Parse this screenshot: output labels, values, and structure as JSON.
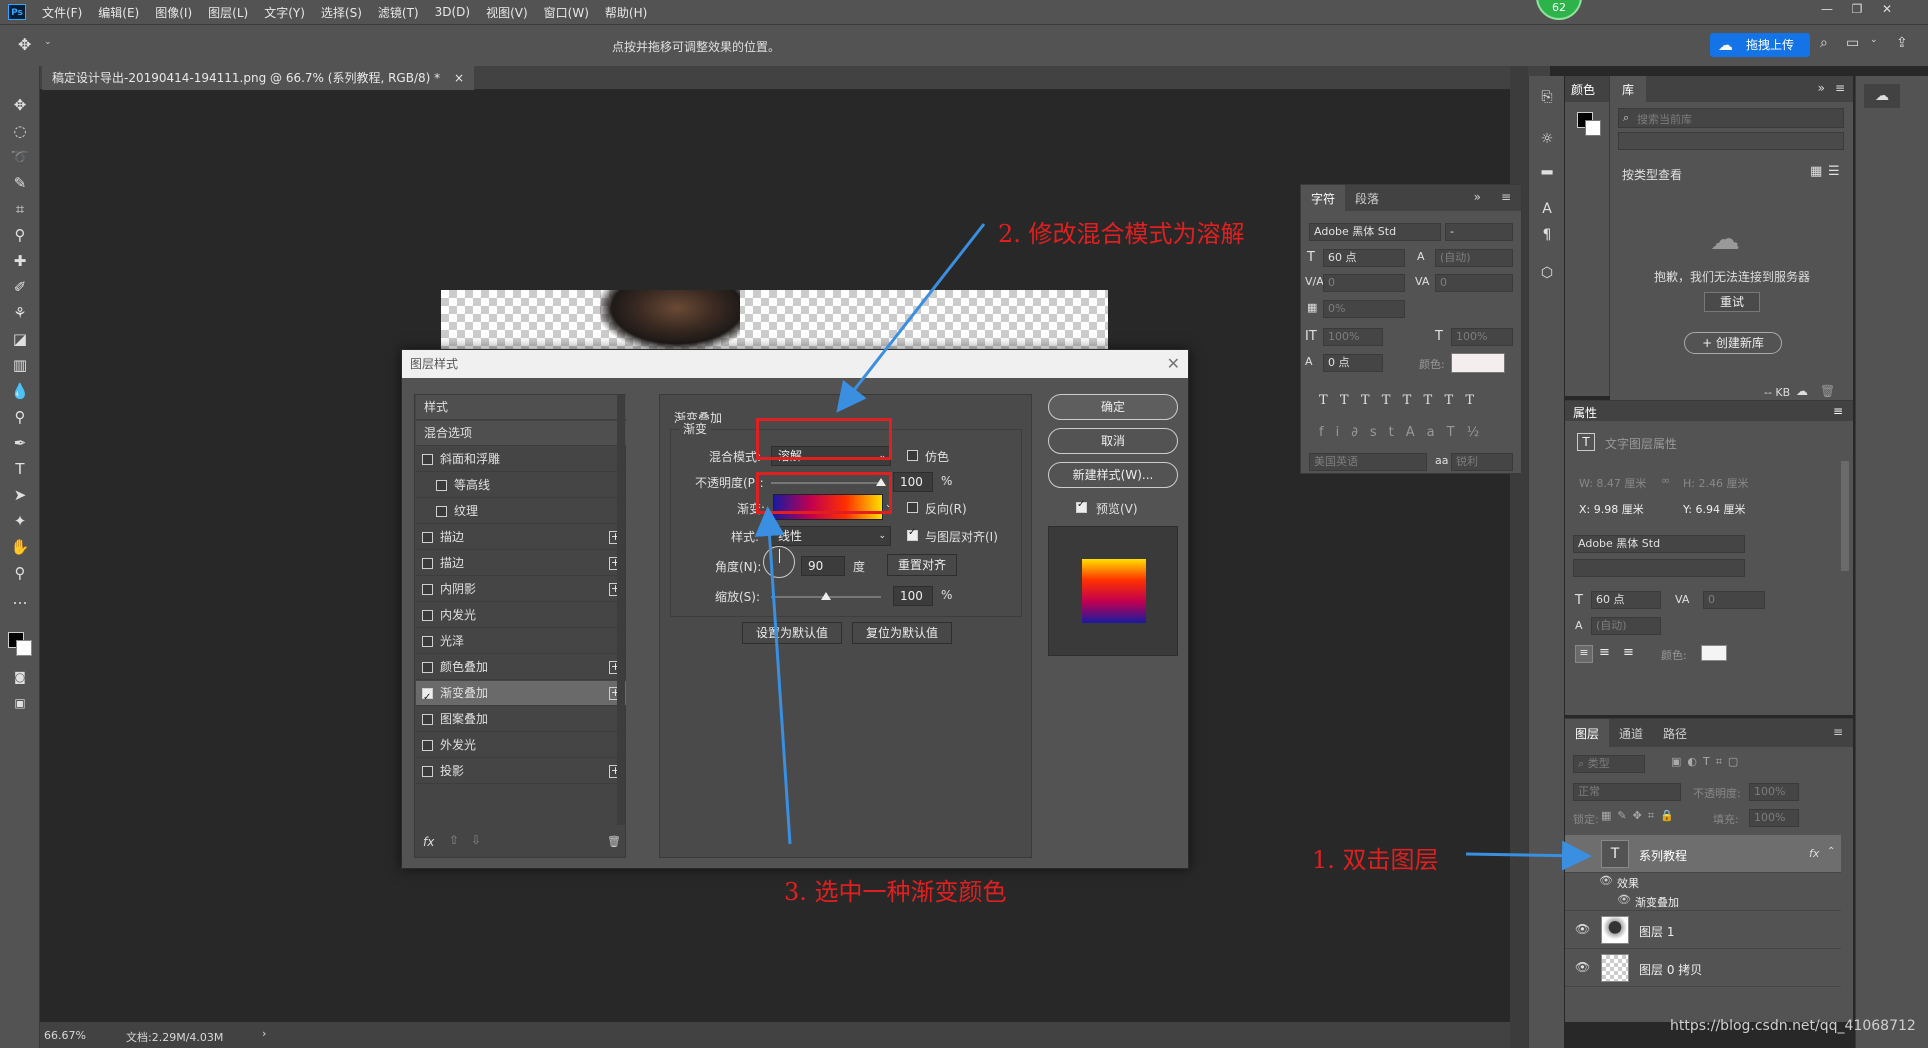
{
  "menu": {
    "logo": "Ps",
    "items": [
      "文件(F)",
      "编辑(E)",
      "图像(I)",
      "图层(L)",
      "文字(Y)",
      "选择(S)",
      "滤镜(T)",
      "3D(D)",
      "视图(V)",
      "窗口(W)",
      "帮助(H)"
    ],
    "badge": "62"
  },
  "options": {
    "hint": "点按并拖移可调整效果的位置。",
    "upload_label": "拖拽上传"
  },
  "document": {
    "tab_title": "稿定设计导出-20190414-194111.png @ 66.7% (系列教程, RGB/8) *",
    "zoom": "66.67%",
    "doc_size": "文档:2.29M/4.03M"
  },
  "dialog": {
    "title": "图层样式",
    "styles_header": "样式",
    "blend_options": "混合选项",
    "styles": [
      {
        "label": "斜面和浮雕",
        "checked": false,
        "plus": false,
        "indent": false
      },
      {
        "label": "等高线",
        "checked": false,
        "plus": false,
        "indent": true
      },
      {
        "label": "纹理",
        "checked": false,
        "plus": false,
        "indent": true
      },
      {
        "label": "描边",
        "checked": false,
        "plus": true,
        "indent": false
      },
      {
        "label": "描边",
        "checked": false,
        "plus": true,
        "indent": false
      },
      {
        "label": "内阴影",
        "checked": false,
        "plus": true,
        "indent": false
      },
      {
        "label": "内发光",
        "checked": false,
        "plus": false,
        "indent": false
      },
      {
        "label": "光泽",
        "checked": false,
        "plus": false,
        "indent": false
      },
      {
        "label": "颜色叠加",
        "checked": false,
        "plus": true,
        "indent": false
      },
      {
        "label": "渐变叠加",
        "checked": true,
        "plus": true,
        "indent": false
      },
      {
        "label": "图案叠加",
        "checked": false,
        "plus": false,
        "indent": false
      },
      {
        "label": "外发光",
        "checked": false,
        "plus": false,
        "indent": false
      },
      {
        "label": "投影",
        "checked": false,
        "plus": true,
        "indent": false
      }
    ],
    "fx_label": "fx",
    "section_title": "渐变叠加",
    "group_title": "渐变",
    "blend_mode_label": "混合模式:",
    "blend_mode_value": "溶解",
    "dither_label": "仿色",
    "opacity_label": "不透明度(P):",
    "opacity_value": "100",
    "opacity_fraction": 1.0,
    "percent": "%",
    "gradient_label": "渐变:",
    "reverse_label": "反向(R)",
    "style_label": "样式:",
    "style_value": "线性",
    "align_label": "与图层对齐(I)",
    "angle_label": "角度(N):",
    "angle_value": "90",
    "degree": "度",
    "reset_align": "重置对齐",
    "scale_label": "缩放(S):",
    "scale_value": "100",
    "scale_fraction": 0.5,
    "set_default": "设置为默认值",
    "reset_default": "复位为默认值",
    "ok": "确定",
    "cancel": "取消",
    "new_style": "新建样式(W)...",
    "preview": "预览(V)"
  },
  "char_panel": {
    "tab_char": "字符",
    "tab_para": "段落",
    "font": "Adobe 黑体 Std",
    "font_style": "-",
    "size": "60 点",
    "leading": "(自动)",
    "kerning": "0",
    "tracking": "0",
    "scale_pct": "0%",
    "vscale": "100%",
    "hscale": "100%",
    "baseline": "0 点",
    "color_label": "颜色:",
    "lang": "美国英语",
    "aa": "锐利"
  },
  "library": {
    "tab_color": "颜色",
    "tab_lib": "库",
    "search_placeholder": "搜索当前库",
    "view_by": "按类型查看",
    "error": "抱歉，我们无法连接到服务器",
    "retry": "重试",
    "create": "+ 创建新库",
    "kb": "-- KB"
  },
  "properties": {
    "title": "属性",
    "subtitle": "文字图层属性",
    "w": "W: 8.47 厘米",
    "h": "H: 2.46 厘米",
    "x": "X: 9.98 厘米",
    "y": "Y: 6.94 厘米",
    "font": "Adobe 黑体 Std",
    "size": "60 点",
    "tracking": "0",
    "leading": "(自动)",
    "color_label": "颜色:"
  },
  "layers": {
    "tab_layers": "图层",
    "tab_channels": "通道",
    "tab_paths": "路径",
    "filter": "类型",
    "blend": "正常",
    "opacity_label": "不透明度:",
    "opacity": "100%",
    "lock_label": "锁定:",
    "fill_label": "填充:",
    "fill": "100%",
    "items": [
      {
        "name": "系列教程",
        "type": "text"
      },
      {
        "name": "效果",
        "type": "sub"
      },
      {
        "name": "渐变叠加",
        "type": "sub2"
      },
      {
        "name": "图层 1",
        "type": "image"
      },
      {
        "name": "图层 0 拷贝",
        "type": "transparent"
      }
    ]
  },
  "annotations": {
    "a1": "1. 双击图层",
    "a2": "2. 修改混合模式为溶解",
    "a3": "3. 选中一种渐变颜色"
  },
  "watermark": "https://blog.csdn.net/qq_41068712",
  "colors": {
    "annotation": "#e02020",
    "arrow": "#3a8fe0",
    "gradient": [
      "#1a1aa0",
      "#c00050",
      "#ff3000",
      "#ffe000"
    ]
  }
}
